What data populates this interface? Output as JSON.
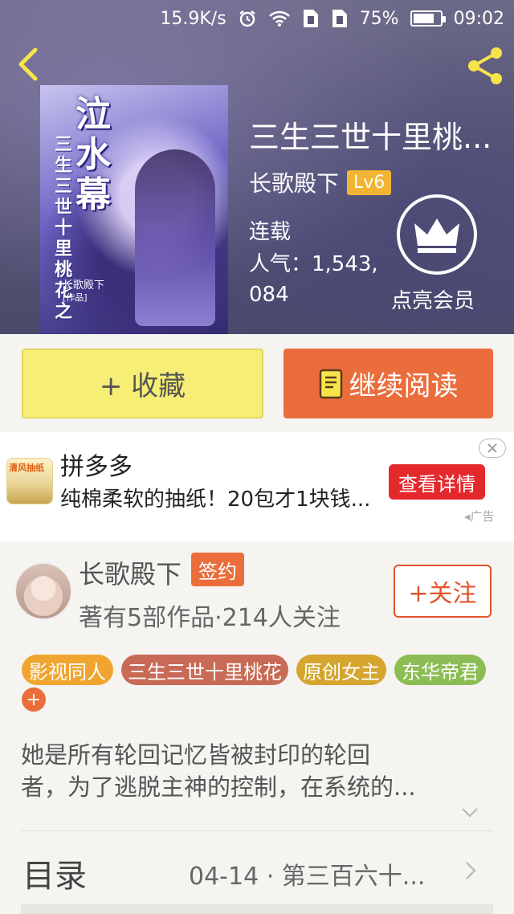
{
  "status_bar": {
    "speed": "15.9K/s",
    "battery_pct": "75%",
    "battery_level": 0.75,
    "time": "09:02"
  },
  "cover": {
    "title": "泣水幕",
    "subtitle": "三生三世十里桃花之",
    "author": "长歌殿下",
    "sign": "[作品]"
  },
  "book": {
    "title": "三生三世十里桃...",
    "author": "长歌殿下",
    "level": "Lv6",
    "status": "连载",
    "popularity": "人气：1,543,084",
    "vip_label": "点亮会员"
  },
  "actions": {
    "favorite": "+ 收藏",
    "continue_reading": "继续阅读"
  },
  "ad": {
    "thumb_text": "清风抽纸",
    "title": "拼多多",
    "description": "纯棉柔软的抽纸！20包才1块钱...",
    "button": "查看详情",
    "label": "广告"
  },
  "author_card": {
    "name": "长歌殿下",
    "badge": "签约",
    "stats": "著有5部作品·214人关注",
    "follow": "+关注"
  },
  "tags": [
    {
      "label": "影视同人",
      "color": "#f0a530"
    },
    {
      "label": "三生三世十里桃花",
      "color": "#c86a55"
    },
    {
      "label": "原创女主",
      "color": "#d6a52e"
    },
    {
      "label": "东华帝君",
      "color": "#8cbd54"
    }
  ],
  "tag_more": "+",
  "description": {
    "line1": "她是所有轮回记忆皆被封印的轮回",
    "line2": "者，为了逃脱主神的控制，在系统的..."
  },
  "toc": {
    "label": "目录",
    "latest": "04-14 · 第三百六十..."
  },
  "colors": {
    "accent_orange": "#ea6d3b",
    "fav_yellow": "#f7ee76",
    "ad_red": "#e4292d",
    "level_gold": "#f2b533"
  }
}
